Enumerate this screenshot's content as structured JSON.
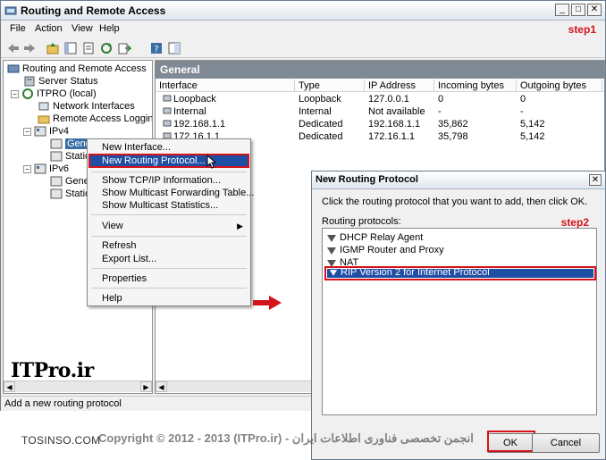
{
  "window": {
    "title": "Routing and Remote Access",
    "step_label": "step1"
  },
  "menu": [
    "File",
    "Action",
    "View",
    "Help"
  ],
  "tree": {
    "root": "Routing and Remote Access",
    "server_status": "Server Status",
    "server": "ITPRO (local)",
    "network_interfaces": "Network Interfaces",
    "remote_access": "Remote Access Logging & P",
    "ipv4": "IPv4",
    "ipv4_general": "General",
    "ipv4_static": "Static",
    "ipv6": "IPv6",
    "ipv6_general": "Genera",
    "ipv6_static": "Static"
  },
  "logo": "ITPro.ir",
  "list": {
    "header": "General",
    "columns": [
      "Interface",
      "Type",
      "IP Address",
      "Incoming bytes",
      "Outgoing bytes"
    ],
    "rows": [
      {
        "interface": "Loopback",
        "type": "Loopback",
        "ip": "127.0.0.1",
        "incoming": "0",
        "outgoing": "0"
      },
      {
        "interface": "Internal",
        "type": "Internal",
        "ip": "Not available",
        "incoming": "-",
        "outgoing": "-"
      },
      {
        "interface": "192.168.1.1",
        "type": "Dedicated",
        "ip": "192.168.1.1",
        "incoming": "35,862",
        "outgoing": "5,142"
      },
      {
        "interface": "172.16.1.1",
        "type": "Dedicated",
        "ip": "172.16.1.1",
        "incoming": "35,798",
        "outgoing": "5,142"
      }
    ]
  },
  "context_menu": {
    "new_interface": "New Interface...",
    "new_routing_protocol": "New Routing Protocol...",
    "show_tcpip": "Show TCP/IP Information...",
    "show_multicast_fwd": "Show Multicast Forwarding Table...",
    "show_multicast_stats": "Show Multicast Statistics...",
    "view": "View",
    "refresh": "Refresh",
    "export_list": "Export List...",
    "properties": "Properties",
    "help": "Help"
  },
  "status_bar": "Add a new routing protocol",
  "dialog": {
    "title": "New Routing Protocol",
    "instruction": "Click the routing protocol that you want to add, then click OK.",
    "list_label": "Routing protocols:",
    "step_label": "step2",
    "protocols": [
      "DHCP Relay Agent",
      "IGMP Router and Proxy",
      "NAT",
      "RIP Version 2 for Internet Protocol"
    ],
    "ok": "OK",
    "cancel": "Cancel"
  },
  "footer": {
    "site": "TOSINSO.COM",
    "copyright": "Copyright © 2012 - 2013 (ITPro.ir) - انجمن تخصصی فناوری اطلاعات ایران"
  },
  "colors": {
    "highlight": "#1f4ea5",
    "annotation_red": "#d4141a",
    "pane_header": "#7f8a95"
  }
}
